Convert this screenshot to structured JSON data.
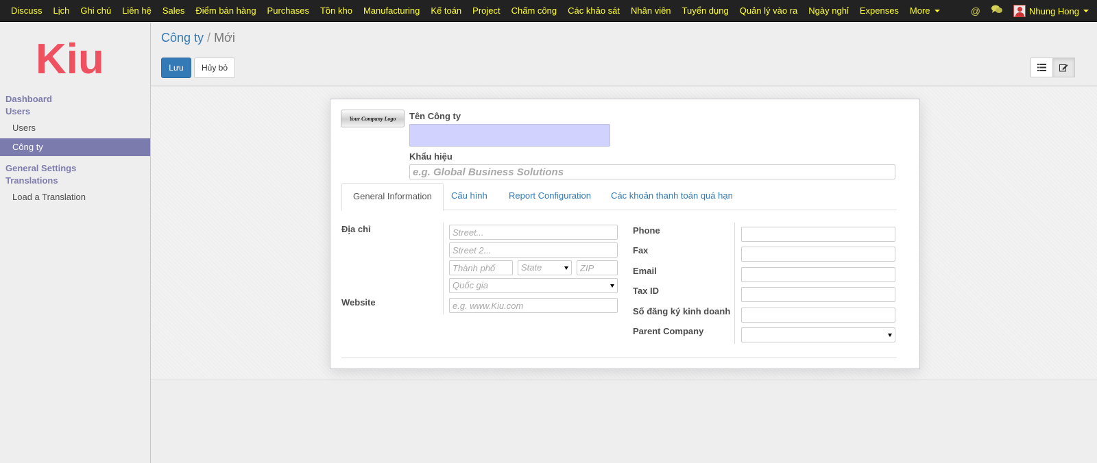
{
  "topbar": {
    "menu": [
      "Discuss",
      "Lịch",
      "Ghi chú",
      "Liên hệ",
      "Sales",
      "Điểm bán hàng",
      "Purchases",
      "Tồn kho",
      "Manufacturing",
      "Kế toán",
      "Project",
      "Chấm công",
      "Các khảo sát",
      "Nhân viên",
      "Tuyển dụng",
      "Quản lý vào ra",
      "Ngày nghỉ",
      "Expenses"
    ],
    "more_label": "More",
    "mention_icon": "@",
    "chat_icon": "chat-icon",
    "user_name": "Nhung Hong"
  },
  "sidebar": {
    "logo_text": "Kiu",
    "logo_color": "#ef5160",
    "section_dashboard": "Dashboard",
    "section_users": "Users",
    "item_users": "Users",
    "item_company": "Công ty",
    "section_general_settings": "General Settings",
    "section_translations": "Translations",
    "item_load_translation": "Load a Translation"
  },
  "control_panel": {
    "breadcrumb_parent": "Công ty",
    "breadcrumb_separator": "/",
    "breadcrumb_current": "Mới",
    "save_label": "Lưu",
    "discard_label": "Hủy bỏ"
  },
  "form": {
    "logo_text": "Your Company Logo",
    "company_name_label": "Tên Công ty",
    "company_name_value": "",
    "slogan_label": "Khẩu hiệu",
    "slogan_placeholder": "e.g. Global Business Solutions",
    "tabs": [
      "General Information",
      "Cấu hình",
      "Report Configuration",
      "Các khoản thanh toán quá hạn"
    ],
    "address_label": "Địa chỉ",
    "street_placeholder": "Street...",
    "street2_placeholder": "Street 2...",
    "city_placeholder": "Thành phố",
    "state_placeholder": "State",
    "zip_placeholder": "ZIP",
    "country_placeholder": "Quốc gia",
    "website_label": "Website",
    "website_placeholder": "e.g. www.Kiu.com",
    "phone_label": "Phone",
    "fax_label": "Fax",
    "email_label": "Email",
    "tax_id_label": "Tax ID",
    "registry_label": "Số đăng ký kinh doanh",
    "parent_company_label": "Parent Company"
  }
}
